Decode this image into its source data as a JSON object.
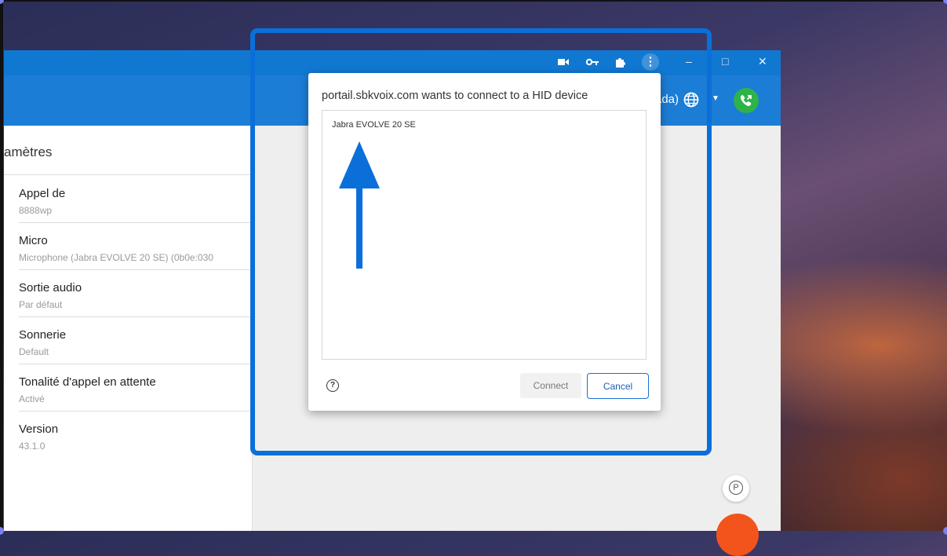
{
  "app": {
    "header": {
      "language_text": "ada)",
      "icons": [
        "globe-icon",
        "caret-down-icon",
        "phone-call-icon"
      ]
    },
    "titlebar": {
      "icons": [
        "video-camera-icon",
        "key-icon",
        "puzzle-extension-icon",
        "more-vert-icon"
      ],
      "minimize": "–",
      "maximize": "□",
      "close": "✕"
    },
    "settings": {
      "title": "amètres",
      "items": [
        {
          "label": "Appel de",
          "value": "8888wp"
        },
        {
          "label": "Micro",
          "value": "Microphone (Jabra EVOLVE 20 SE) (0b0e:030"
        },
        {
          "label": "Sortie audio",
          "value": "Par défaut"
        },
        {
          "label": "Sonnerie",
          "value": "Default"
        },
        {
          "label": "Tonalité d'appel en attente",
          "value": "Activé"
        },
        {
          "label": "Version",
          "value": "43.1.0"
        }
      ]
    },
    "park_label": "P"
  },
  "dialog": {
    "title": "portail.sbkvoix.com wants to connect to a HID device",
    "devices": [
      "Jabra EVOLVE 20 SE"
    ],
    "help_icon": "?",
    "connect_label": "Connect",
    "cancel_label": "Cancel"
  },
  "colors": {
    "accent_blue": "#1c7dd6",
    "annotation_blue": "#0b6fd9",
    "call_green": "#2eb34a",
    "fab_orange": "#f2541b"
  }
}
